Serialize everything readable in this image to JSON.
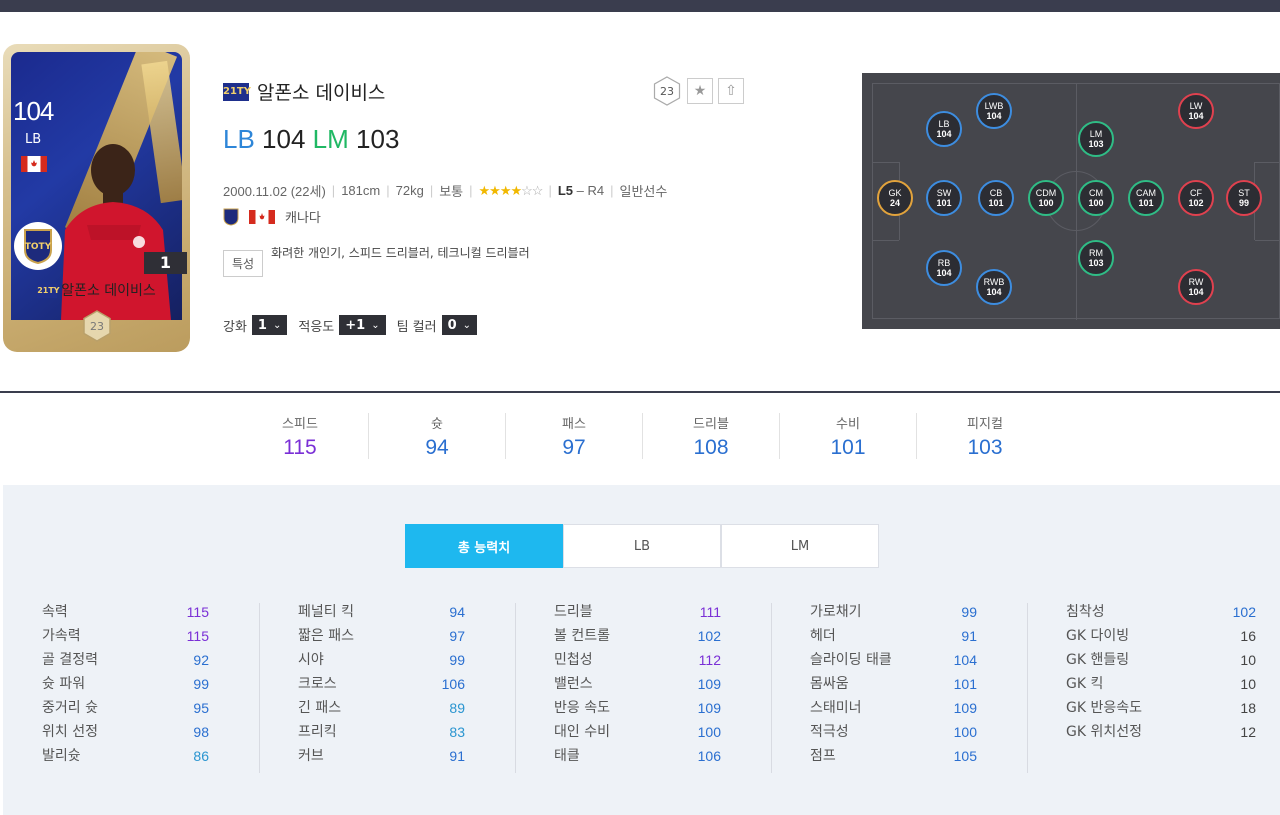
{
  "card": {
    "ovr": "104",
    "position": "LB",
    "level": "1",
    "name": "알폰소 데이비스",
    "season_tag": "21TY",
    "season_number": "23"
  },
  "player": {
    "season_tag": "21TY",
    "name": "알폰소 데이비스",
    "positions": [
      {
        "pos": "LB",
        "ovr": "104"
      },
      {
        "pos": "LM",
        "ovr": "103"
      }
    ],
    "birth": "2000.11.02 (22세)",
    "height": "181cm",
    "weight": "72kg",
    "build": "보통",
    "stars_on": "★★★★",
    "stars_off": "☆☆",
    "foot_left": "L5",
    "foot_right": "– R4",
    "type": "일반선수",
    "nation": "캐나다",
    "trait_label": "특성",
    "traits": "화려한 개인기, 스피드 드리블러, 테크니컬 드리블러",
    "season_badge": "23"
  },
  "selectors": {
    "enhance_label": "강화",
    "enhance_value": "1",
    "adapt_label": "적응도",
    "adapt_value": "+1",
    "teamcolor_label": "팀 컬러",
    "teamcolor_value": "0"
  },
  "pitch": {
    "nodes": [
      {
        "pos": "GK",
        "val": "24",
        "group": "gk"
      },
      {
        "pos": "SW",
        "val": "101",
        "group": "df"
      },
      {
        "pos": "LB",
        "val": "104",
        "group": "df"
      },
      {
        "pos": "CB",
        "val": "101",
        "group": "df"
      },
      {
        "pos": "RB",
        "val": "104",
        "group": "df"
      },
      {
        "pos": "LWB",
        "val": "104",
        "group": "df"
      },
      {
        "pos": "RWB",
        "val": "104",
        "group": "df"
      },
      {
        "pos": "CDM",
        "val": "100",
        "group": "mf"
      },
      {
        "pos": "LM",
        "val": "103",
        "group": "mf"
      },
      {
        "pos": "CM",
        "val": "100",
        "group": "mf"
      },
      {
        "pos": "RM",
        "val": "103",
        "group": "mf"
      },
      {
        "pos": "CAM",
        "val": "101",
        "group": "mf"
      },
      {
        "pos": "LW",
        "val": "104",
        "group": "fw"
      },
      {
        "pos": "CF",
        "val": "102",
        "group": "fw"
      },
      {
        "pos": "RW",
        "val": "104",
        "group": "fw"
      },
      {
        "pos": "ST",
        "val": "99",
        "group": "fw"
      }
    ]
  },
  "summary": [
    {
      "label": "스피드",
      "value": "115",
      "color": "#7a2fd6"
    },
    {
      "label": "슛",
      "value": "94",
      "color": "#2a6fd0"
    },
    {
      "label": "패스",
      "value": "97",
      "color": "#2a6fd0"
    },
    {
      "label": "드리블",
      "value": "108",
      "color": "#2a6fd0"
    },
    {
      "label": "수비",
      "value": "101",
      "color": "#2a6fd0"
    },
    {
      "label": "피지컬",
      "value": "103",
      "color": "#2a6fd0"
    }
  ],
  "tabs": [
    "총 능력치",
    "LB",
    "LM"
  ],
  "stats": [
    [
      {
        "k": "속력",
        "v": "115",
        "c": "c-purple"
      },
      {
        "k": "가속력",
        "v": "115",
        "c": "c-purple"
      },
      {
        "k": "골 결정력",
        "v": "92",
        "c": "c-blue"
      },
      {
        "k": "슛 파워",
        "v": "99",
        "c": "c-blue"
      },
      {
        "k": "중거리 슛",
        "v": "95",
        "c": "c-blue"
      },
      {
        "k": "위치 선정",
        "v": "98",
        "c": "c-blue"
      },
      {
        "k": "발리슛",
        "v": "86",
        "c": "c-teal"
      }
    ],
    [
      {
        "k": "페널티 킥",
        "v": "94",
        "c": "c-blue"
      },
      {
        "k": "짧은 패스",
        "v": "97",
        "c": "c-blue"
      },
      {
        "k": "시야",
        "v": "99",
        "c": "c-blue"
      },
      {
        "k": "크로스",
        "v": "106",
        "c": "c-blue"
      },
      {
        "k": "긴 패스",
        "v": "89",
        "c": "c-teal"
      },
      {
        "k": "프리킥",
        "v": "83",
        "c": "c-teal"
      },
      {
        "k": "커브",
        "v": "91",
        "c": "c-blue"
      }
    ],
    [
      {
        "k": "드리블",
        "v": "111",
        "c": "c-purple"
      },
      {
        "k": "볼 컨트롤",
        "v": "102",
        "c": "c-blue"
      },
      {
        "k": "민첩성",
        "v": "112",
        "c": "c-purple"
      },
      {
        "k": "밸런스",
        "v": "109",
        "c": "c-blue"
      },
      {
        "k": "반응 속도",
        "v": "109",
        "c": "c-blue"
      },
      {
        "k": "대인 수비",
        "v": "100",
        "c": "c-blue"
      },
      {
        "k": "태클",
        "v": "106",
        "c": "c-blue"
      }
    ],
    [
      {
        "k": "가로채기",
        "v": "99",
        "c": "c-blue"
      },
      {
        "k": "헤더",
        "v": "91",
        "c": "c-blue"
      },
      {
        "k": "슬라이딩 태클",
        "v": "104",
        "c": "c-blue"
      },
      {
        "k": "몸싸움",
        "v": "101",
        "c": "c-blue"
      },
      {
        "k": "스태미너",
        "v": "109",
        "c": "c-blue"
      },
      {
        "k": "적극성",
        "v": "100",
        "c": "c-blue"
      },
      {
        "k": "점프",
        "v": "105",
        "c": "c-blue"
      }
    ],
    [
      {
        "k": "침착성",
        "v": "102",
        "c": "c-blue"
      },
      {
        "k": "GK 다이빙",
        "v": "16",
        "c": "c-gray"
      },
      {
        "k": "GK 핸들링",
        "v": "10",
        "c": "c-gray"
      },
      {
        "k": "GK 킥",
        "v": "10",
        "c": "c-gray"
      },
      {
        "k": "GK 반응속도",
        "v": "18",
        "c": "c-gray"
      },
      {
        "k": "GK 위치선정",
        "v": "12",
        "c": "c-gray"
      }
    ]
  ]
}
